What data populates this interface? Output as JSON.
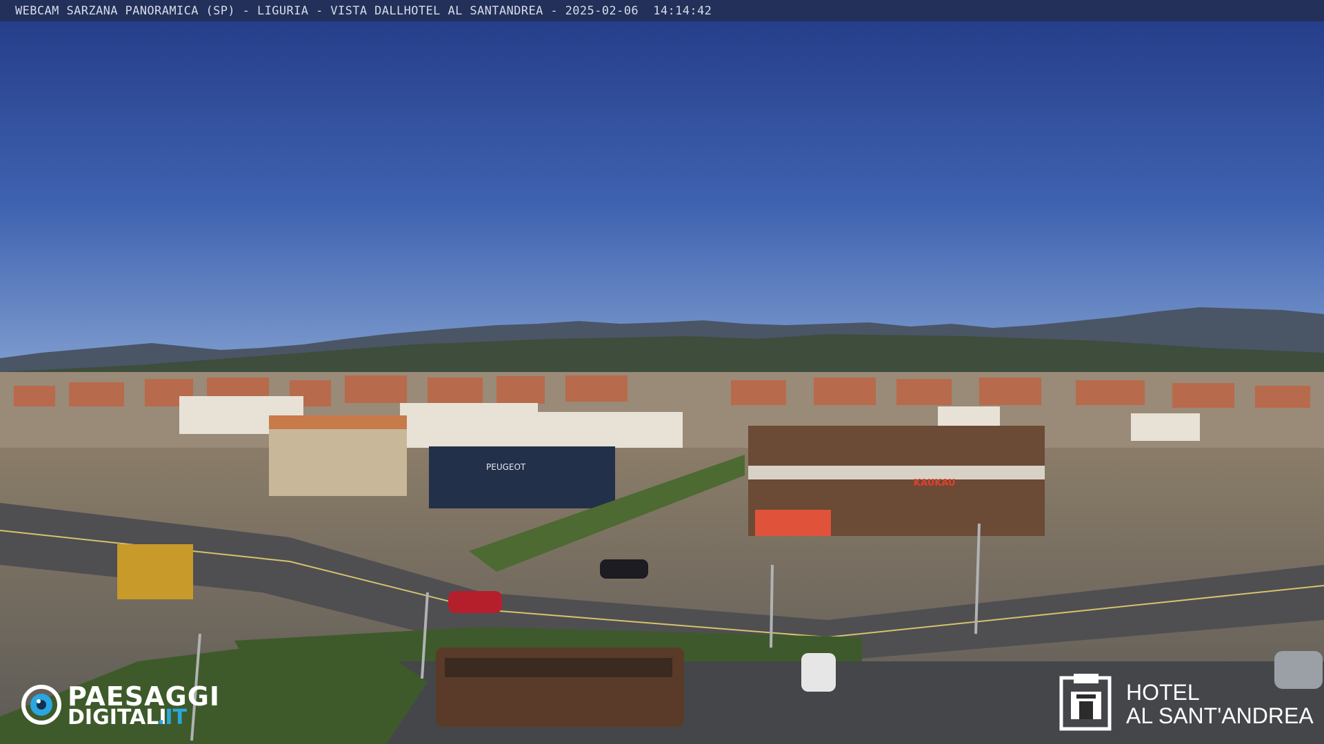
{
  "overlay": {
    "caption": "WEBCAM SARZANA PANORAMICA (SP) - LIGURIA - VISTA DALLHOTEL AL SANTANDREA - 2025-02-06  14:14:42"
  },
  "brand_left": {
    "line1": "PAESAGGI",
    "line2a": "DIGITALI",
    "line2b": ".IT",
    "icon": "eye-icon",
    "accent_color": "#2aa7e0"
  },
  "brand_right": {
    "line1": "HOTEL",
    "line2": "AL SANT'ANDREA",
    "icon": "hotel-emblem-icon"
  },
  "scene": {
    "signs": {
      "peugeot": "PEUGEOT",
      "kaukau": "KAUKAU"
    },
    "colors": {
      "sky_top": "#27408c",
      "sky_bottom": "#6f8fc6",
      "hills": "#3b4a45"
    }
  }
}
